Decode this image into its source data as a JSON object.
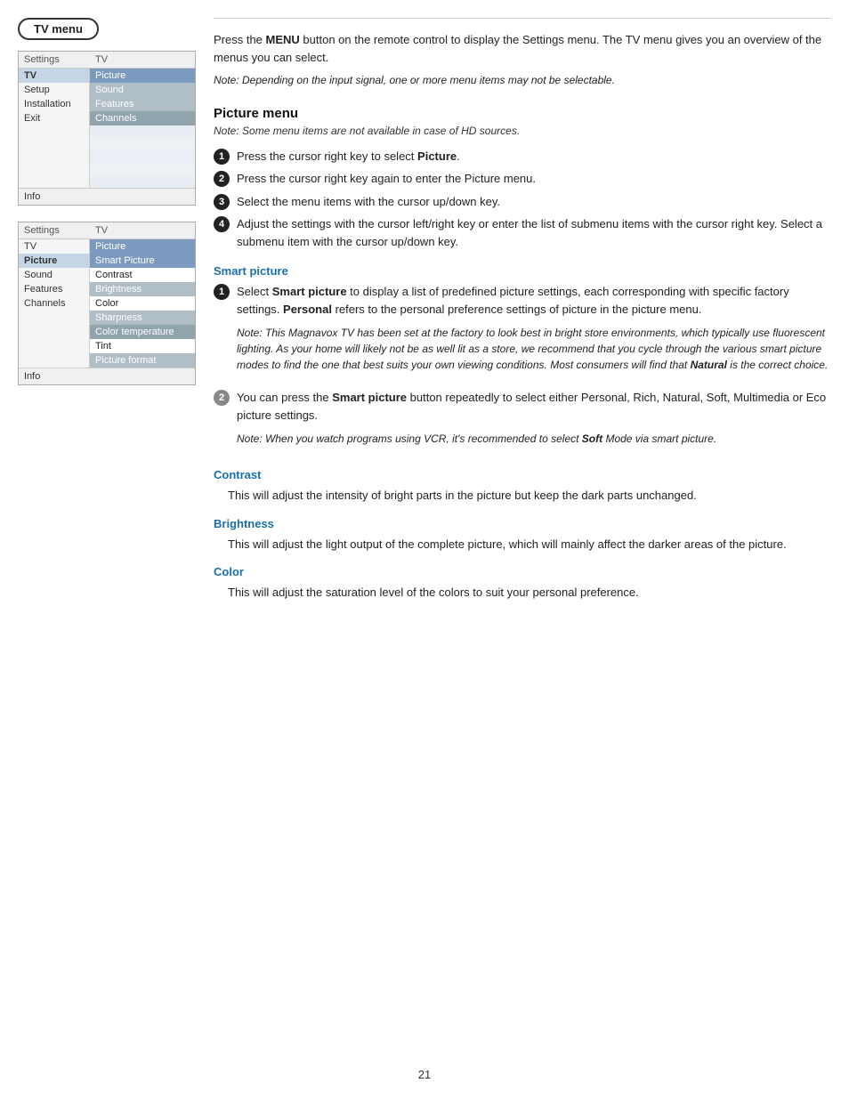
{
  "badge": {
    "label": "TV menu"
  },
  "menu_box_1": {
    "header": {
      "col1": "Settings",
      "col2": "TV"
    },
    "rows": [
      {
        "left": "TV",
        "right": "Picture",
        "right_class": "highlighted"
      },
      {
        "left": "Setup",
        "right": "Sound",
        "right_class": "grey-highlight"
      },
      {
        "left": "Installation",
        "right": "Features",
        "right_class": "grey-highlight"
      },
      {
        "left": "Exit",
        "right": "Channels",
        "right_class": "dark-grey"
      }
    ],
    "blank_rows": 5,
    "info": "Info"
  },
  "menu_box_2": {
    "header": {
      "col1": "Settings",
      "col2": "TV"
    },
    "left_rows": [
      "TV",
      "Picture",
      "Sound",
      "Features",
      "Channels"
    ],
    "right_col_header": "Picture",
    "right_rows": [
      {
        "label": "Smart Picture",
        "class": "highlighted"
      },
      {
        "label": "Contrast",
        "class": ""
      },
      {
        "label": "Brightness",
        "class": "grey-highlight"
      },
      {
        "label": "Color",
        "class": ""
      },
      {
        "label": "Sharpness",
        "class": "grey-highlight"
      },
      {
        "label": "Color temperature",
        "class": "dark-grey"
      },
      {
        "label": "Tint",
        "class": ""
      },
      {
        "label": "Picture format",
        "class": "grey-highlight"
      }
    ],
    "blank_rows": 0,
    "info": "Info"
  },
  "right_panel": {
    "intro": "Press the MENU button on the remote control to display the Settings menu. The TV menu gives you an overview of the menus you can select.",
    "intro_note": "Note: Depending on the input signal, one or more menu items may not be selectable.",
    "picture_menu": {
      "title": "Picture menu",
      "note": "Note: Some menu items are not available in case of HD sources.",
      "steps": [
        "Press the cursor right key to select Picture.",
        "Press the cursor right key again to enter the Picture menu.",
        "Select the menu items with the cursor up/down key.",
        "Adjust the settings with the cursor left/right key or enter the list of submenu items with the cursor right key. Select a submenu item with the cursor up/down key."
      ]
    },
    "smart_picture": {
      "title": "Smart picture",
      "item1": {
        "main": "Select Smart picture to display a list of predefined picture settings, each corresponding with specific factory settings.",
        "bold_part": "Personal",
        "bold_after": "refers to the personal preference settings of picture in the picture menu.",
        "note": "Note: This Magnavox TV has been set at the factory to look best in bright store environments, which typically use fluorescent lighting. As your home will likely not be as well lit as a store, we recommend that you cycle through the various smart picture modes to find the one that best suits your own viewing conditions. Most consumers will find that Natural is the correct choice."
      },
      "item2": {
        "main": "You can press the Smart picture button repeatedly to select either Personal, Rich, Natural, Soft, Multimedia or Eco picture settings.",
        "note": "Note: When you watch programs using VCR, it's recommended to select Soft Mode via smart picture."
      }
    },
    "contrast": {
      "title": "Contrast",
      "text": "This will adjust the intensity of bright parts in the picture but keep the dark parts unchanged."
    },
    "brightness": {
      "title": "Brightness",
      "text": "This will adjust the light output of the complete picture, which will mainly affect the darker areas of the picture."
    },
    "color": {
      "title": "Color",
      "text": "This will adjust the saturation level of the colors to suit your personal preference."
    }
  },
  "page_number": "21"
}
